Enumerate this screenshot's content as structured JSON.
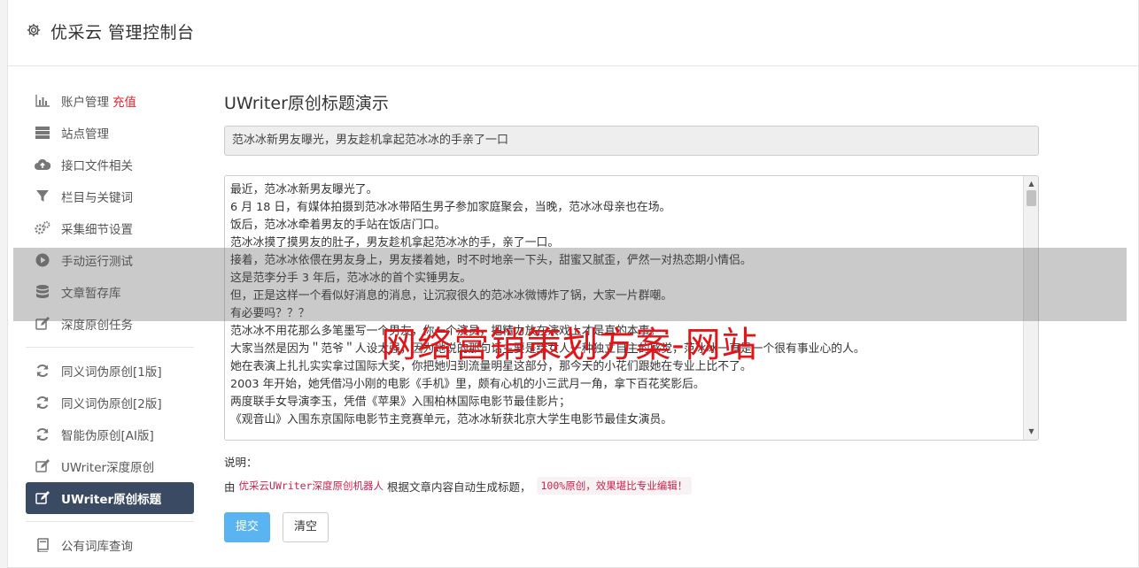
{
  "header": {
    "title": "优采云 管理控制台"
  },
  "sidebar": {
    "group1": [
      {
        "label": "账户管理",
        "badge": "充值",
        "icon": "bar-chart-icon"
      },
      {
        "label": "站点管理",
        "icon": "server-icon"
      },
      {
        "label": "接口文件相关",
        "icon": "cloud-upload-icon"
      },
      {
        "label": "栏目与关键词",
        "icon": "filter-icon"
      },
      {
        "label": "采集细节设置",
        "icon": "gears-icon"
      },
      {
        "label": "手动运行测试",
        "icon": "play-circle-icon"
      },
      {
        "label": "文章暂存库",
        "icon": "database-icon"
      },
      {
        "label": "深度原创任务",
        "icon": "edit-icon"
      }
    ],
    "group2": [
      {
        "label": "同义词伪原创[1版]",
        "icon": "refresh-icon"
      },
      {
        "label": "同义词伪原创[2版]",
        "icon": "refresh-icon"
      },
      {
        "label": "智能伪原创[AI版]",
        "icon": "refresh-icon"
      },
      {
        "label": "UWriter深度原创",
        "icon": "edit-icon"
      },
      {
        "label": "UWriter原创标题",
        "icon": "edit-icon",
        "active": true
      }
    ],
    "group3": [
      {
        "label": "公有词库查询",
        "icon": "book-icon"
      }
    ]
  },
  "main": {
    "title": "UWriter原创标题演示",
    "title_value": "范冰冰新男友曝光，男友趁机拿起范冰冰的手亲了一口",
    "article_lines": [
      "最近，范冰冰新男友曝光了。",
      "6 月 18 日，有媒体拍摄到范冰冰带陌生男子参加家庭聚会，当晚，范冰冰母亲也在场。",
      "饭后，范冰冰牵着男友的手站在饭店门口。",
      "范冰冰摸了摸男友的肚子，男友趁机拿起范冰冰的手，亲了一口。",
      "接着，范冰冰依偎在男友身上，男友搂着她，时不时地亲一下头，甜蜜又腻歪，俨然一对热恋期小情侣。",
      "这是范李分手 3 年后，范冰冰的首个实锤男友。",
      "但，正是这样一个看似好消息的消息，让沉寂很久的范冰冰微博炸了锅，大家一片群嘲。",
      "有必要吗？？？",
      "范冰冰不用花那么多笔墨写一个男友，你一个演员，把精力放在演戏上才是真的本事。",
      "大家当然是因为＂范爷＂人设太强，因为她说的那句话主要是给女人一种独立自主的感觉，范冰冰一直是一个很有事业心的人。",
      "她在表演上扎扎实实拿过国际大奖，你把她归到流量明星这部分，那今天的小花们跟她在专业上比不了。",
      "2003 年开始，她凭借冯小刚的电影《手机》里，颇有心机的小三武月一角，拿下百花奖影后。",
      "两度联手女导演李玉，凭借《苹果》入围柏林国际电影节最佳影片；",
      "《观音山》入围东京国际电影节主竞赛单元，范冰冰斩获北京大学生电影节最佳女演员。"
    ],
    "note_label": "说明：",
    "note_prefix": "由",
    "note_highlight": "优采云UWriter深度原创机器人",
    "note_middle": "根据文章内容自动生成标题，",
    "note_code": "100%原创，效果堪比专业编辑！",
    "submit_label": "提交",
    "clear_label": "清空"
  },
  "watermark": "网络营销策划方案-网站",
  "colors": {
    "active_nav": "#3a4a63",
    "primary_button": "#5bb4f2",
    "badge": "#d9262c",
    "watermark": "#e0161b"
  }
}
